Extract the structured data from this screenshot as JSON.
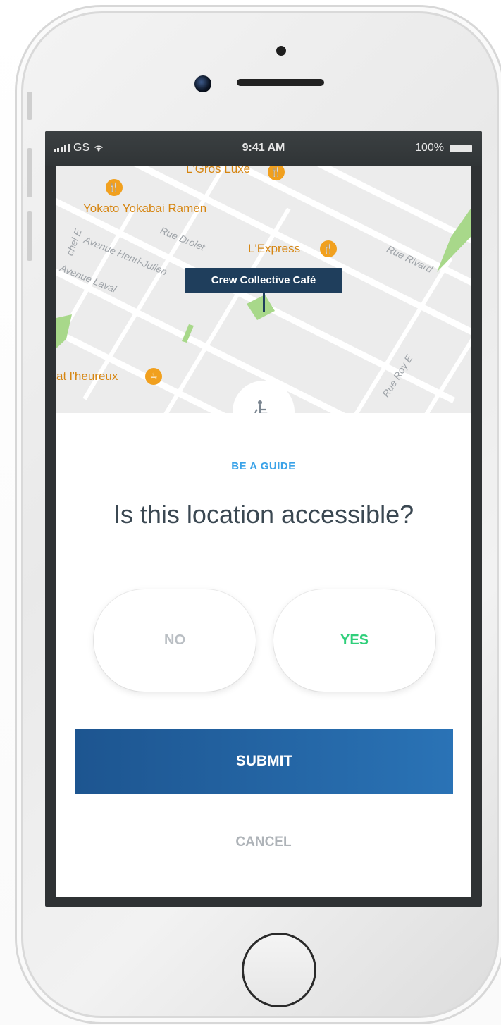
{
  "status_bar": {
    "carrier": "GS",
    "time": "9:41 AM",
    "battery": "100%"
  },
  "map": {
    "pois": [
      {
        "name": "L'Gros Luxe",
        "icon": "restaurant-icon"
      },
      {
        "name": "Yokato Yokabai Ramen",
        "icon": "restaurant-icon"
      },
      {
        "name": "L'Express",
        "icon": "restaurant-icon"
      },
      {
        "name": "at l'heureux",
        "icon": "cafe-icon"
      }
    ],
    "streets": [
      "Avenue Henri-Julien",
      "Rue Drolet",
      "Avenue Laval",
      "Rue Rivard",
      "Rue Roy E",
      "chel E"
    ],
    "selected_place": "Crew Collective Café",
    "badge_icon": "wheelchair-icon"
  },
  "sheet": {
    "eyebrow": "BE A GUIDE",
    "question": "Is this location accessible?",
    "no_label": "NO",
    "yes_label": "YES",
    "submit_label": "SUBMIT",
    "cancel_label": "CANCEL"
  },
  "colors": {
    "accent_blue": "#3aa2e8",
    "submit_blue": "#2a73b6",
    "callout_navy": "#1f3e5c",
    "yes_green": "#2fcf7a",
    "poi_orange": "#f1a01e"
  }
}
